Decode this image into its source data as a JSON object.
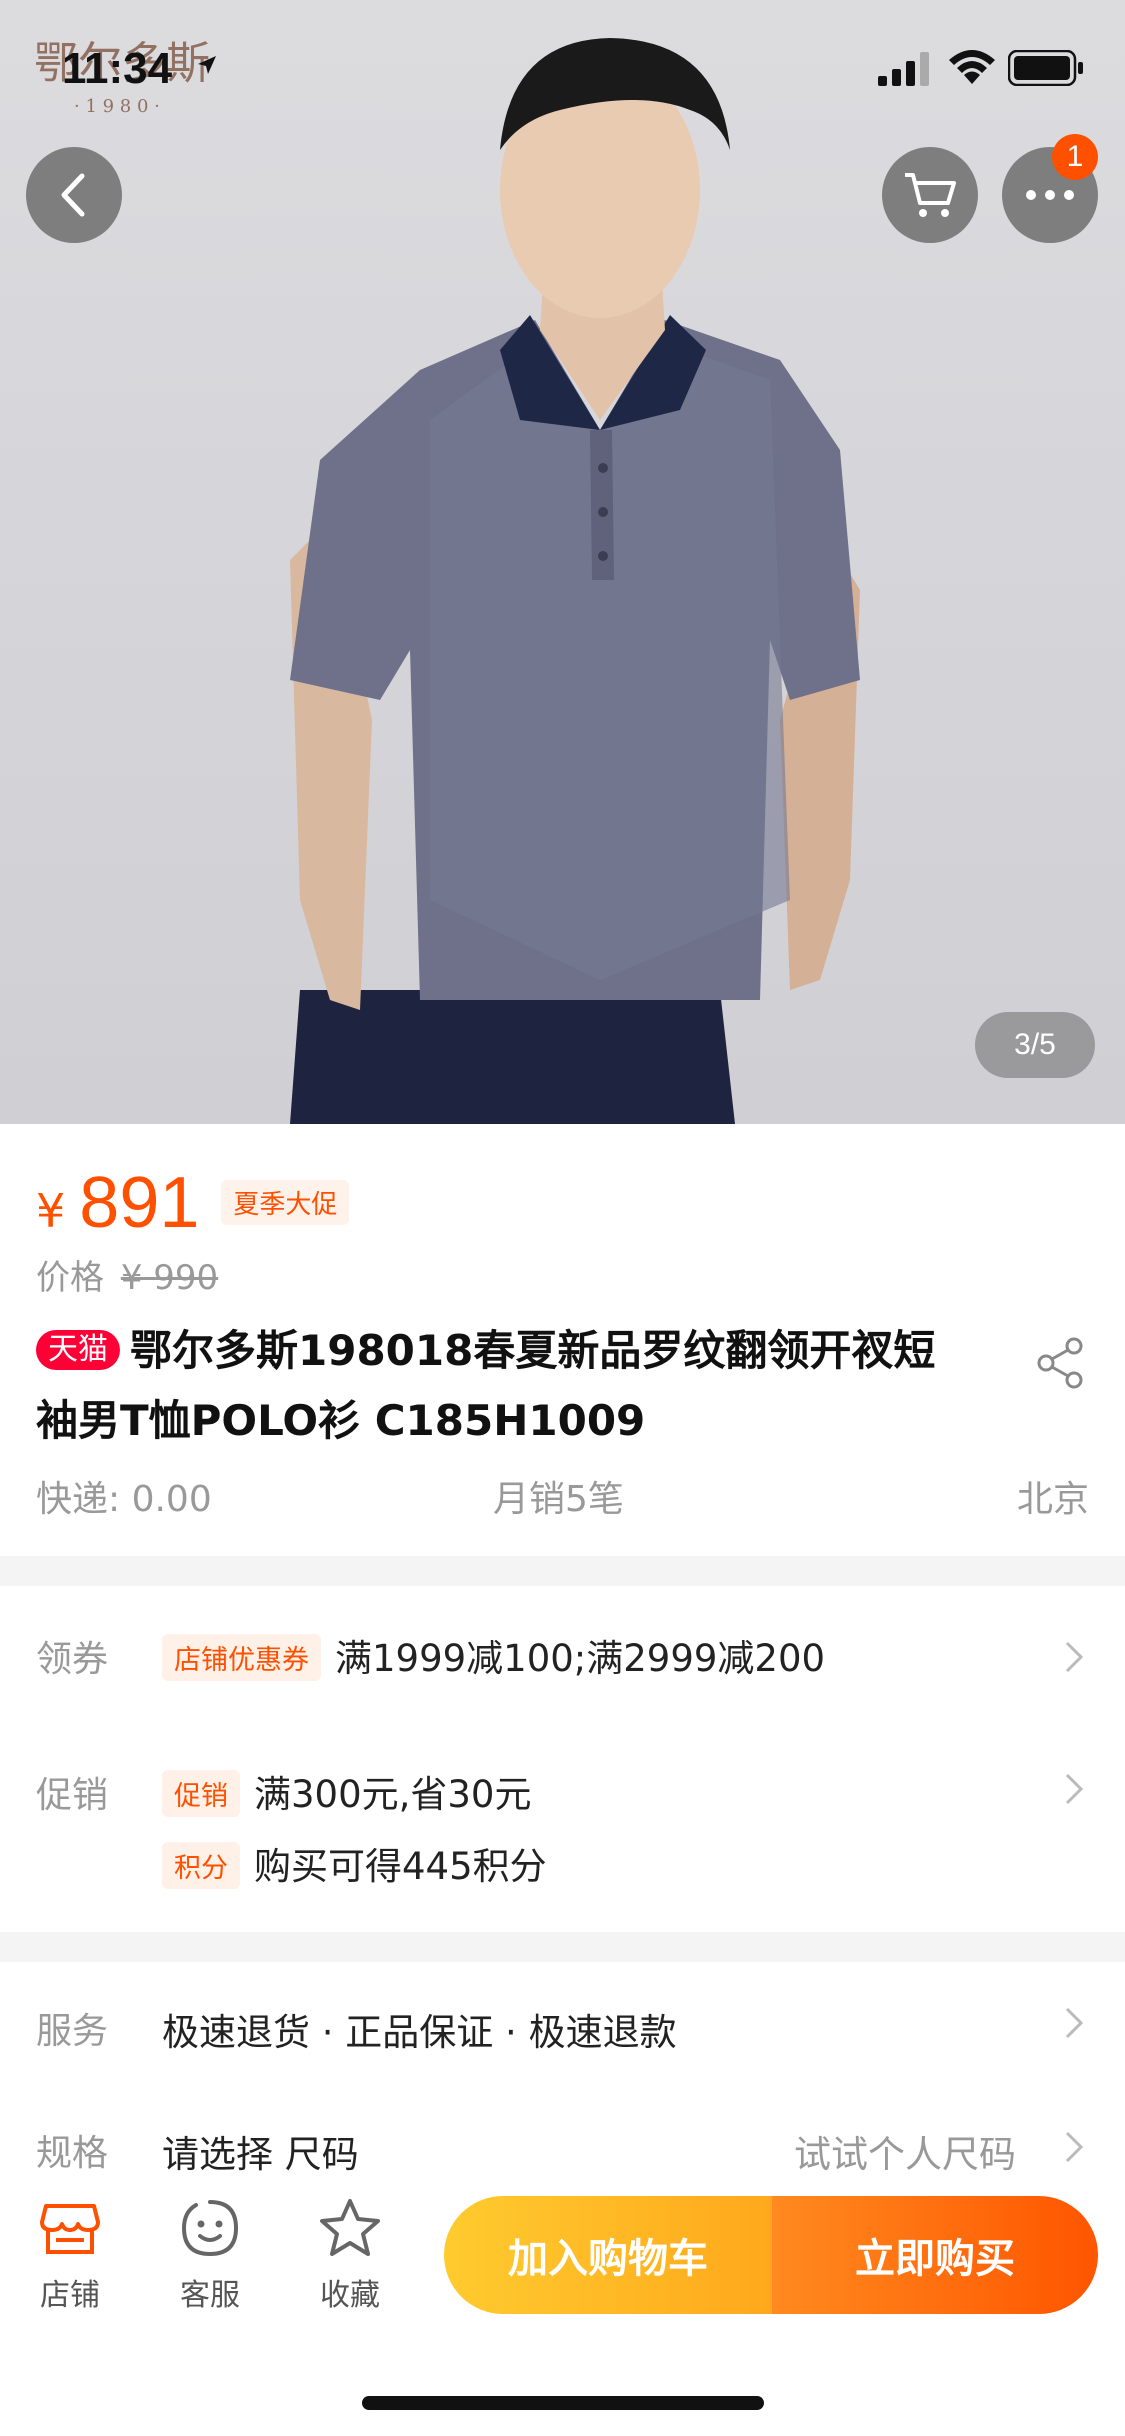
{
  "status_bar": {
    "time": "11:34"
  },
  "brand_logo": {
    "text": "鄂尔多斯",
    "year": "· 1 9 8 0 ·"
  },
  "nav": {
    "cart_badge": "1"
  },
  "gallery": {
    "indicator": "3/5"
  },
  "product": {
    "price_symbol": "¥",
    "price": "891",
    "promo_tag": "夏季大促",
    "original_label": "价格",
    "original_price": "¥ 990",
    "store_badge": "天猫",
    "title": "鄂尔多斯198018春夏新品罗纹翻领开衩短袖男T恤POLO衫 C185H1009",
    "shipping": "快递: 0.00",
    "monthly_sales": "月销5笔",
    "location": "北京"
  },
  "coupon": {
    "label": "领券",
    "chip": "店铺优惠券",
    "text": "满1999减100;满2999减200"
  },
  "promotion": {
    "label": "促销",
    "items": [
      {
        "chip": "促销",
        "text": "满300元,省30元"
      },
      {
        "chip": "积分",
        "text": "购买可得445积分"
      }
    ]
  },
  "service": {
    "label": "服务",
    "text": "极速退货 · 正品保证 · 极速退款"
  },
  "spec": {
    "label": "规格",
    "text": "请选择 尺码",
    "hint": "试试个人尺码"
  },
  "bottom_bar": {
    "store": "店铺",
    "service": "客服",
    "favorite": "收藏",
    "add_to_cart": "加入购物车",
    "buy_now": "立即购买"
  },
  "colors": {
    "accent": "#ff5000",
    "tmall": "#ff0036",
    "cart_btn": "#ffb422",
    "buy_btn": "#ff6a12"
  }
}
